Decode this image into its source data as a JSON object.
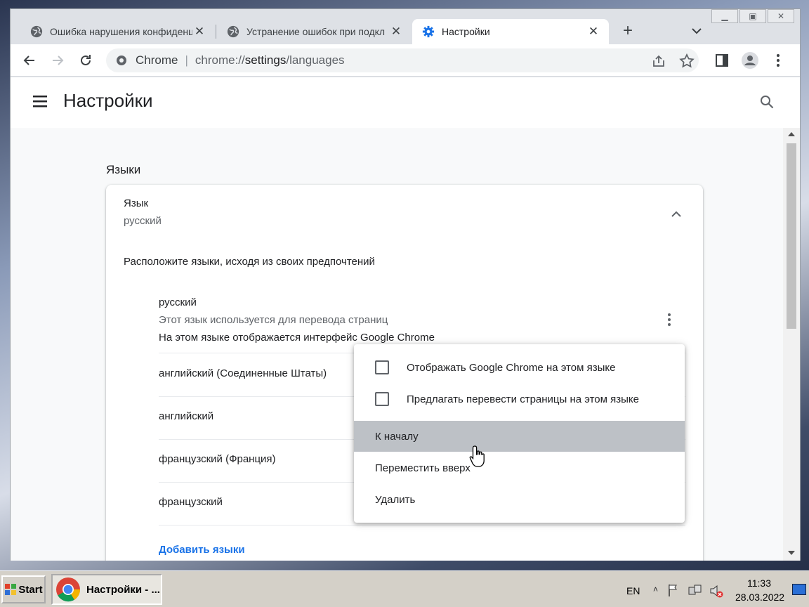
{
  "browser": {
    "tabs": [
      {
        "title": "Ошибка нарушения конфиденц",
        "icon": "globe-icon",
        "active": false
      },
      {
        "title": "Устранение ошибок при подкл",
        "icon": "globe-icon",
        "active": false
      },
      {
        "title": "Настройки",
        "icon": "gear-icon",
        "active": true
      }
    ],
    "new_tab_glyph": "+",
    "omnibox": {
      "scheme_label": "Chrome",
      "url_prefix": "chrome://",
      "url_host": "settings",
      "url_path": "/languages"
    }
  },
  "settings": {
    "page_title": "Настройки",
    "section_title": "Языки",
    "language_card": {
      "heading": "Язык",
      "current_language": "русский",
      "reorder_hint": "Расположите языки, исходя из своих предпочтений",
      "languages": [
        {
          "name": "русский",
          "line2": "Этот язык используется для перевода страниц",
          "line3": "На этом языке отображается интерфейс Google Chrome"
        },
        {
          "name": "английский (Соединенные Штаты)"
        },
        {
          "name": "английский"
        },
        {
          "name": "французский (Франция)"
        },
        {
          "name": "французский"
        }
      ],
      "add_languages": "Добавить языки"
    },
    "context_menu": {
      "display_in_language": "Отображать Google Chrome на этом языке",
      "offer_translate": "Предлагать перевести страницы на этом языке",
      "move_to_top": "К началу",
      "move_up": "Переместить вверх",
      "remove": "Удалить"
    }
  },
  "taskbar": {
    "start_label": "Start",
    "chrome_window": "Настройки - ...",
    "language": "EN",
    "time": "11:33",
    "date": "28.03.2022"
  },
  "colors": {
    "accent": "#1a73e8",
    "menu_hover": "#bdc1c6"
  }
}
